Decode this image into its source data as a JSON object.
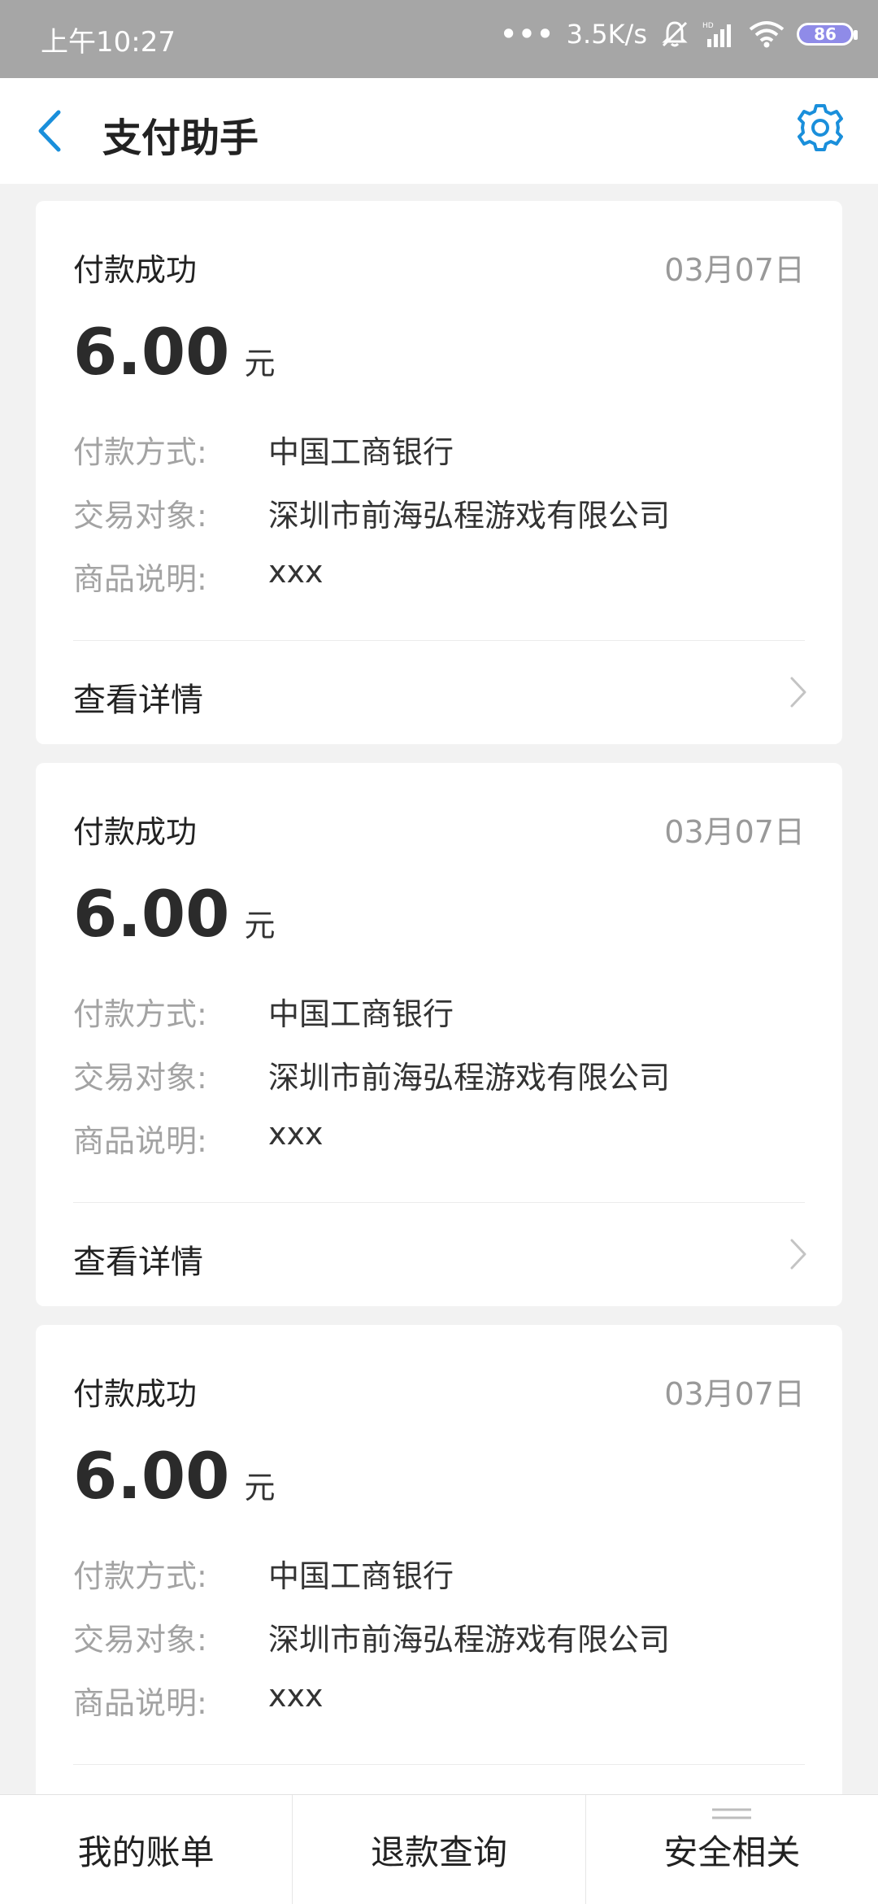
{
  "status_bar": {
    "time": "上午10:27",
    "network_speed": "3.5K/s",
    "battery": "86"
  },
  "header": {
    "title": "支付助手",
    "back_icon": "back-arrow-icon",
    "settings_icon": "gear-icon"
  },
  "labels": {
    "method": "付款方式:",
    "merchant": "交易对象:",
    "description": "商品说明:",
    "details": "查看详情",
    "unit": "元"
  },
  "cards": [
    {
      "status": "付款成功",
      "date": "03月07日",
      "amount": "6.00",
      "method": "中国工商银行",
      "merchant": "深圳市前海弘程游戏有限公司",
      "description": "xxx"
    },
    {
      "status": "付款成功",
      "date": "03月07日",
      "amount": "6.00",
      "method": "中国工商银行",
      "merchant": "深圳市前海弘程游戏有限公司",
      "description": "xxx"
    },
    {
      "status": "付款成功",
      "date": "03月07日",
      "amount": "6.00",
      "method": "中国工商银行",
      "merchant": "深圳市前海弘程游戏有限公司",
      "description": "xxx"
    }
  ],
  "bottom_nav": {
    "bills": "我的账单",
    "refund": "退款查询",
    "security": "安全相关"
  },
  "colors": {
    "accent": "#1a8fdb",
    "status_bar_bg": "#a6a6a6",
    "page_bg": "#f2f2f2",
    "muted_text": "#a3a3a3"
  }
}
